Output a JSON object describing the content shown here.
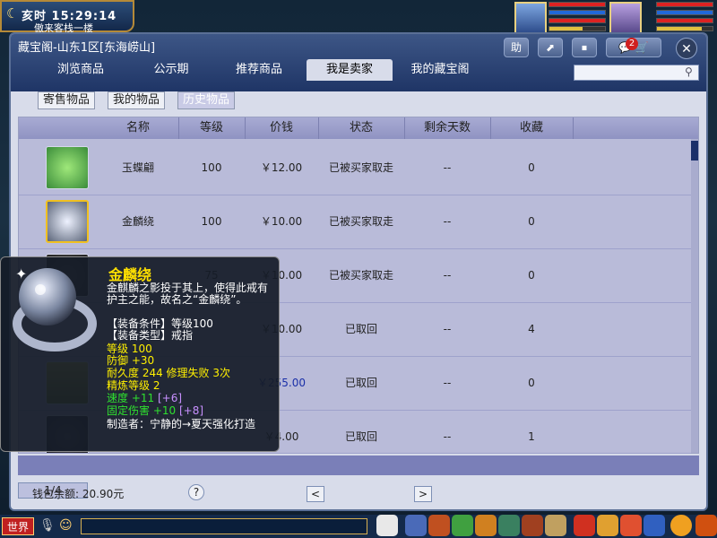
{
  "hud": {
    "clock_period": "亥时",
    "clock_time": "15:29:14",
    "location": "傲来客栈一楼"
  },
  "window": {
    "title": "藏宝阁-山东1区[东海崂山]",
    "buttons": {
      "help": "助",
      "share": "⬈",
      "stop": "⏹",
      "chat": "💬",
      "cart": "🛒"
    },
    "chat_badge": "2",
    "close": "✕"
  },
  "tabs": [
    {
      "label": "浏览商品",
      "active": false
    },
    {
      "label": "公示期",
      "active": false
    },
    {
      "label": "推荐商品",
      "active": false
    },
    {
      "label": "我是卖家",
      "active": true
    },
    {
      "label": "我的藏宝阁",
      "active": false
    }
  ],
  "search": {
    "placeholder": ""
  },
  "subtabs": [
    {
      "label": "寄售物品",
      "active": false
    },
    {
      "label": "我的物品",
      "active": false
    },
    {
      "label": "历史物品",
      "active": true
    }
  ],
  "table": {
    "headers": [
      "名称",
      "等级",
      "价钱",
      "状态",
      "剩余天数",
      "收藏"
    ],
    "rows": [
      {
        "name": "玉蝶翩",
        "level": "100",
        "price": "￥12.00",
        "status": "已被买家取走",
        "days": "--",
        "fav": "0",
        "thumb": "green-leaf"
      },
      {
        "name": "金麟绕",
        "level": "100",
        "price": "￥10.00",
        "status": "已被买家取走",
        "days": "--",
        "fav": "0",
        "thumb": "silver-ring"
      },
      {
        "name": "",
        "level": "75",
        "price": "￥10.00",
        "status": "已被买家取走",
        "days": "--",
        "fav": "0",
        "thumb": "dark-gear"
      },
      {
        "name": "",
        "level": "",
        "price": "￥10.00",
        "status": "已取回",
        "days": "--",
        "fav": "4",
        "thumb": "hidden"
      },
      {
        "name": "",
        "level": "",
        "price": "￥255.00",
        "status": "已取回",
        "days": "--",
        "fav": "0",
        "thumb": "gold-bar"
      },
      {
        "name": "",
        "level": "",
        "price": "￥4.00",
        "status": "已取回",
        "days": "--",
        "fav": "1",
        "thumb": "dark-armor"
      }
    ]
  },
  "footer": {
    "balance": "钱包余额: 20.90元",
    "help": "?",
    "prev": "<",
    "page": "1/4",
    "next": ">"
  },
  "tooltip": {
    "name": "金麟绕",
    "desc": "金麒麟之影投于其上，使得此戒有护主之能，故名之“金麟绕”。",
    "equip_req": "【装备条件】等级100",
    "equip_type": "【装备类型】戒指",
    "level": "等级 100",
    "defense": "防御 +30",
    "durability": "耐久度 244  修理失败 3次",
    "refine": "精炼等级 2",
    "speed": "速度 +11",
    "speed_bonus": "[+6]",
    "fixed_dmg": "固定伤害 +10",
    "fixed_bonus": "[+8]",
    "maker": "制造者：宁静的→夏天强化打造"
  },
  "bottombar": {
    "world": "世界"
  },
  "colors": {
    "accent": "#1f3566",
    "table_bg": "#b9bbd9",
    "tooltip_title": "#ffe000"
  }
}
